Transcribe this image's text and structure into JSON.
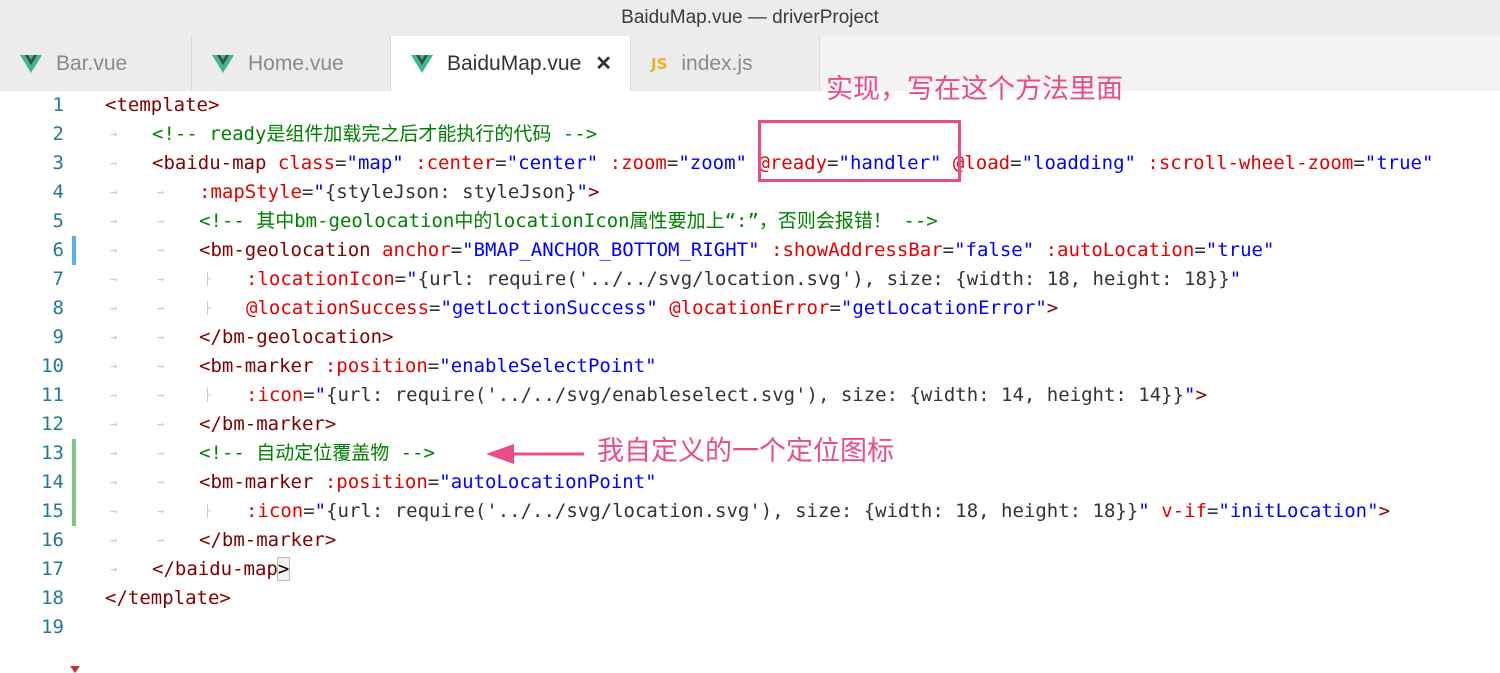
{
  "window": {
    "title": "BaiduMap.vue — driverProject"
  },
  "tabs": [
    {
      "label": "Bar.vue",
      "icon": "vue-icon",
      "active": false
    },
    {
      "label": "Home.vue",
      "icon": "vue-icon",
      "active": false
    },
    {
      "label": "BaiduMap.vue",
      "icon": "vue-icon",
      "active": true,
      "close": "✕"
    },
    {
      "label": "index.js",
      "icon": "js-icon",
      "active": false,
      "icon_text": "JS"
    }
  ],
  "colors": {
    "tag": "#800000",
    "attribute": "#e50000",
    "string": "#0000ff",
    "comment": "#008000",
    "annotation": "#e94c8b",
    "line_number": "#237893"
  },
  "editor": {
    "line_numbers": [
      "1",
      "2",
      "3",
      "4",
      "5",
      "6",
      "7",
      "8",
      "9",
      "10",
      "11",
      "12",
      "13",
      "14",
      "15",
      "16",
      "17",
      "18",
      "19"
    ],
    "lines": [
      [
        [
          "tg",
          "<template>"
        ]
      ],
      [
        [
          "cm",
          "<!-- ready是组件加载完之后才能执行的代码 -->"
        ]
      ],
      [
        [
          "tg",
          "<baidu-map"
        ],
        [
          "pu",
          " "
        ],
        [
          "at",
          "class"
        ],
        [
          "pu",
          "="
        ],
        [
          "st",
          "\"map\""
        ],
        [
          "pu",
          " "
        ],
        [
          "at",
          ":center"
        ],
        [
          "pu",
          "="
        ],
        [
          "st",
          "\"center\""
        ],
        [
          "pu",
          " "
        ],
        [
          "at",
          ":zoom"
        ],
        [
          "pu",
          "="
        ],
        [
          "st",
          "\"zoom\""
        ],
        [
          "pu",
          " "
        ],
        [
          "at",
          "@ready"
        ],
        [
          "pu",
          "="
        ],
        [
          "st",
          "\"handler\""
        ],
        [
          "pu",
          " "
        ],
        [
          "at",
          "@load"
        ],
        [
          "pu",
          "="
        ],
        [
          "st",
          "\"loadding\""
        ],
        [
          "pu",
          " "
        ],
        [
          "at",
          ":scroll-wheel-zoom"
        ],
        [
          "pu",
          "="
        ],
        [
          "st",
          "\"true\""
        ]
      ],
      [
        [
          "at",
          ":mapStyle"
        ],
        [
          "pu",
          "="
        ],
        [
          "st",
          "\""
        ],
        [
          "pu",
          "{styleJson: styleJson}"
        ],
        [
          "st",
          "\""
        ],
        [
          "tg",
          ">"
        ]
      ],
      [
        [
          "cm",
          "<!-- 其中bm-geolocation中的locationIcon属性要加上“:”，否则会报错！ -->"
        ]
      ],
      [
        [
          "tg",
          "<bm-geolocation"
        ],
        [
          "pu",
          " "
        ],
        [
          "at",
          "anchor"
        ],
        [
          "pu",
          "="
        ],
        [
          "st",
          "\"BMAP_ANCHOR_BOTTOM_RIGHT\""
        ],
        [
          "pu",
          " "
        ],
        [
          "at",
          ":showAddressBar"
        ],
        [
          "pu",
          "="
        ],
        [
          "st",
          "\"false\""
        ],
        [
          "pu",
          " "
        ],
        [
          "at",
          ":autoLocation"
        ],
        [
          "pu",
          "="
        ],
        [
          "st",
          "\"true\""
        ]
      ],
      [
        [
          "at",
          ":locationIcon"
        ],
        [
          "pu",
          "="
        ],
        [
          "st",
          "\""
        ],
        [
          "pu",
          "{url: require('../../svg/location.svg'), size: {width: 18, height: 18}}"
        ],
        [
          "st",
          "\""
        ]
      ],
      [
        [
          "at",
          "@locationSuccess"
        ],
        [
          "pu",
          "="
        ],
        [
          "st",
          "\"getLoctionSuccess\""
        ],
        [
          "pu",
          " "
        ],
        [
          "at",
          "@locationError"
        ],
        [
          "pu",
          "="
        ],
        [
          "st",
          "\"getLocationError\""
        ],
        [
          "tg",
          ">"
        ]
      ],
      [
        [
          "tg",
          "</bm-geolocation>"
        ]
      ],
      [
        [
          "tg",
          "<bm-marker"
        ],
        [
          "pu",
          " "
        ],
        [
          "at",
          ":position"
        ],
        [
          "pu",
          "="
        ],
        [
          "st",
          "\"enableSelectPoint\""
        ]
      ],
      [
        [
          "at",
          ":icon"
        ],
        [
          "pu",
          "="
        ],
        [
          "st",
          "\""
        ],
        [
          "pu",
          "{url: require('../../svg/enableselect.svg'), size: {width: 14, height: 14}}"
        ],
        [
          "st",
          "\""
        ],
        [
          "tg",
          ">"
        ]
      ],
      [
        [
          "tg",
          "</bm-marker>"
        ]
      ],
      [
        [
          "cm",
          "<!-- 自动定位覆盖物 -->"
        ]
      ],
      [
        [
          "tg",
          "<bm-marker"
        ],
        [
          "pu",
          " "
        ],
        [
          "at",
          ":position"
        ],
        [
          "pu",
          "="
        ],
        [
          "st",
          "\"autoLocationPoint\""
        ]
      ],
      [
        [
          "at",
          ":icon"
        ],
        [
          "pu",
          "="
        ],
        [
          "st",
          "\""
        ],
        [
          "pu",
          "{url: require('../../svg/location.svg'), size: {width: 18, height: 18}}"
        ],
        [
          "st",
          "\""
        ],
        [
          "pu",
          " "
        ],
        [
          "at",
          "v-if"
        ],
        [
          "pu",
          "="
        ],
        [
          "st",
          "\"initLocation\""
        ],
        [
          "tg",
          ">"
        ]
      ],
      [
        [
          "tg",
          "</bm-marker>"
        ]
      ],
      [
        [
          "tg",
          "</baidu-map"
        ],
        [
          "hl",
          ">"
        ]
      ],
      [
        [
          "tg",
          "</template>"
        ]
      ],
      []
    ],
    "indent": [
      0,
      1,
      1,
      2,
      2,
      2,
      3,
      3,
      2,
      2,
      3,
      2,
      2,
      2,
      3,
      2,
      1,
      0,
      0
    ]
  },
  "annotations": {
    "top_note": "实现，写在这个方法里面",
    "side_note": "我自定义的一个定位图标"
  }
}
